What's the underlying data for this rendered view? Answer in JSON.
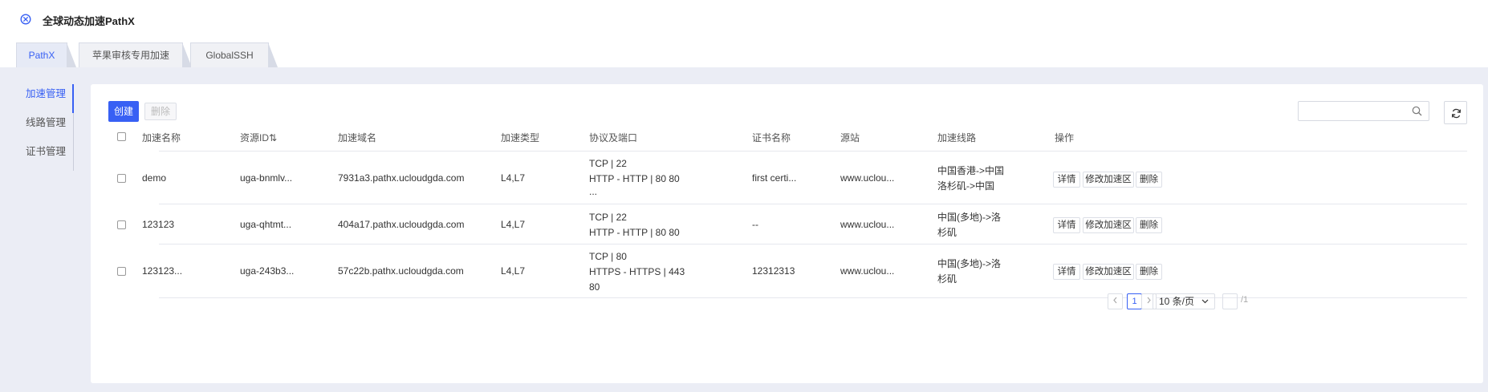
{
  "header": {
    "title": "全球动态加速PathX"
  },
  "tabs": [
    {
      "label": "PathX",
      "active": true
    },
    {
      "label": "苹果审核专用加速",
      "active": false
    },
    {
      "label": "GlobalSSH",
      "active": false
    }
  ],
  "sidenav": [
    {
      "label": "加速管理",
      "active": true
    },
    {
      "label": "线路管理",
      "active": false
    },
    {
      "label": "证书管理",
      "active": false
    }
  ],
  "toolbar": {
    "create_label": "创建",
    "delete_label": "删除",
    "search_placeholder": ""
  },
  "table": {
    "columns": [
      "加速名称",
      "资源ID⇅",
      "加速域名",
      "加速类型",
      "协议及端口",
      "证书名称",
      "源站",
      "加速线路",
      "操作"
    ],
    "rows": [
      {
        "name": "demo",
        "resource_id": "uga-bnmlv...",
        "domain": "7931a3.pathx.ucloudgda.com",
        "type": "L4,L7",
        "protocol": [
          "TCP | 22",
          "HTTP - HTTP | 80 80",
          "..."
        ],
        "cert": "first certi...",
        "origin": "www.uclou...",
        "route": [
          "中国香港->中国",
          "洛杉矶->中国"
        ]
      },
      {
        "name": "123123",
        "resource_id": "uga-qhtmt...",
        "domain": "404a17.pathx.ucloudgda.com",
        "type": "L4,L7",
        "protocol": [
          "TCP | 22",
          "HTTP - HTTP | 80 80"
        ],
        "cert": "--",
        "origin": "www.uclou...",
        "route": [
          "中国(多地)->洛",
          "杉矶"
        ]
      },
      {
        "name": "123123...",
        "resource_id": "uga-243b3...",
        "domain": "57c22b.pathx.ucloudgda.com",
        "type": "L4,L7",
        "protocol": [
          "TCP | 80",
          "HTTPS - HTTPS | 443",
          "80"
        ],
        "cert": "12312313",
        "origin": "www.uclou...",
        "route": [
          "中国(多地)->洛",
          "杉矶"
        ]
      }
    ],
    "actions": [
      "详情",
      "修改加速区",
      "删除"
    ]
  },
  "pagination": {
    "current": "1",
    "page_size": "10 条/页",
    "total_pages": "/1"
  },
  "colors": {
    "accent": "#3860f4",
    "background": "#ebedf5"
  }
}
